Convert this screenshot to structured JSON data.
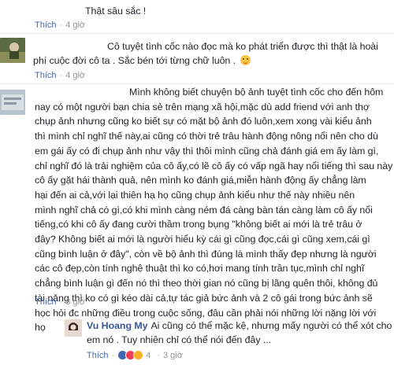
{
  "comments": [
    {
      "text_lines": [
        "Thật sâu sắc !"
      ],
      "like_label": "Thích",
      "time": "4 giờ"
    },
    {
      "text_lines": [
        "Cô tuyệt tình cốc nào đọc mà ko phát triển được thì thật là hoài",
        "phí cuộc đời cô ta . Sắc bén tới từng chữ luôn ."
      ],
      "like_label": "Thích",
      "time": "4 giờ"
    },
    {
      "text_lines": [
        "Mình không biết chuyện bộ ảnh tuyệt tình cốc cho đến hôm",
        "nay có một người bạn chia sẻ trên mạng xã hội,mặc dù add friend với anh thợ",
        "chụp ảnh nhưng cũng ko biết sự có mặt bộ ảnh đó luôn,xem xong vài kiểu ảnh",
        "thì mình chỉ nghĩ thế này,ai cũng có thời trẻ trâu hành động nông nổi nên cho dù",
        "em gái ấy có đi chụp ảnh như vậy thì thôi mình cũng chả đánh giá em ấy làm gì,",
        "chỉ nghĩ đó là trải nghiệm của cô ấy,có lẽ cô ấy có vấp ngã hay nổi tiếng thì sau này",
        "cô ấy gặt hái thành quả, nên mình ko đánh giá,miễn hành động ấy chẳng làm",
        "hại đến ai cả,với lại thiên hạ họ cũng chụp ảnh kiểu như thế này nhiều nên",
        "mình nghĩ chả có gì,có khi mình càng ném đá càng bàn tán càng làm cô ấy nổi",
        "tiếng,có khi cô ấy đang cười thầm trong bụng \"không biết ai mới là trẻ trâu ở",
        "đây? Không biết ai mới là người hiểu kỳ cái gì cũng đọc,cái gì cũng xem,cái gì",
        "cũng bình luận ở đây\", còn về bộ ảnh thì đúng là mình thấy đẹp nhưng là người",
        "các cô đẹp,còn tính nghệ thuật thì ko có,hơi mang tính trần tục,mình chỉ nghĩ",
        "chẳng bình luận gì đến nó thì theo thời gian nó cũng bị lãng quên thôi, không đủ",
        "tài năng thì ko có gì kéo dài cả,tự tác giả bức ảnh và 2 cô gái trong bức ảnh sẽ",
        "học hỏi đc những điều trong cuộc sống, đâu cần phải nói những lời nặng lời với",
        "họ"
      ],
      "like_label": "Thích",
      "time": "3 giờ"
    }
  ],
  "reply": {
    "author": "Vu Hoang My",
    "text_lines": [
      "Ai cũng có thể mặc kệ, nhưng mấy người có thể xót cho",
      "em nó . Tuy nhiên chỉ có thể nói đến đây ..."
    ],
    "like_label": "Thích",
    "reaction_count": "4",
    "time": "3 giờ"
  },
  "colors": {
    "link": "#365899",
    "like": "#4267b2",
    "meta": "#90949c",
    "text": "#1d2129"
  }
}
